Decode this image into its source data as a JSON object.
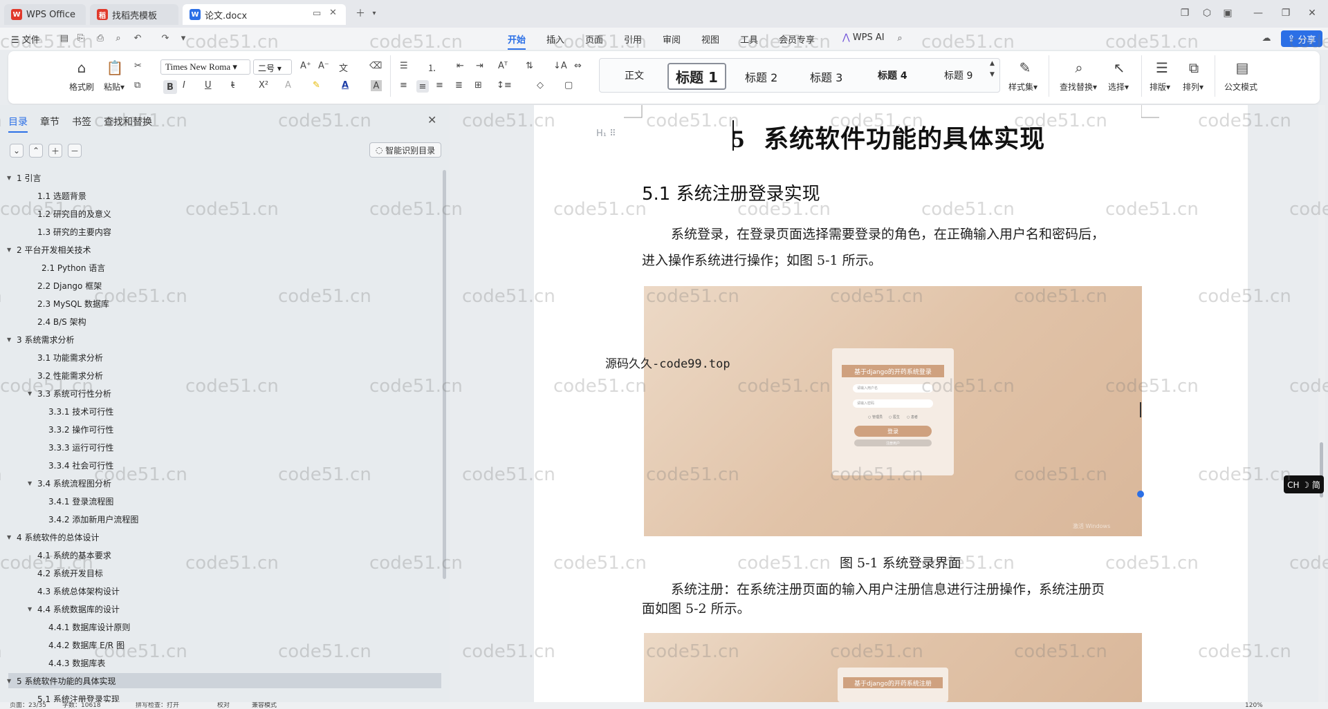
{
  "tabs": [
    {
      "label": "WPS Office",
      "logo": "W",
      "logo_color": "#e0392b"
    },
    {
      "label": "找稻壳模板",
      "logo": "稻",
      "logo_color": "#e0392b"
    },
    {
      "label": "论文.docx",
      "logo": "W",
      "logo_color": "#2b6fe6"
    }
  ],
  "quick": {
    "file": "文件"
  },
  "menu_tabs": [
    "开始",
    "插入",
    "页面",
    "引用",
    "审阅",
    "视图",
    "工具",
    "会员专享"
  ],
  "wps_ai": "WPS AI",
  "share": "分享",
  "ribbon": {
    "format_painter": "格式刷",
    "paste": "粘贴",
    "font": "Times New Roma",
    "size": "二号",
    "styles": [
      "正文",
      "标题 1",
      "标题 2",
      "标题 3",
      "标题 4",
      "标题 9"
    ],
    "style_set": "样式集",
    "find_replace": "查找替换",
    "select": "选择",
    "layout": "排版",
    "arrange": "排列",
    "official_mode": "公文模式",
    "accent": "#2b6fe6"
  },
  "nav": {
    "tabs": [
      "目录",
      "章节",
      "书签",
      "查找和替换"
    ],
    "smart_toc": "智能识别目录",
    "toc": [
      {
        "label": "1  引言",
        "level": 1,
        "caret": true
      },
      {
        "label": "1.1  选题背景",
        "level": 2
      },
      {
        "label": "1.2  研究目的及意义",
        "level": 2
      },
      {
        "label": "1.3  研究的主要内容",
        "level": 2
      },
      {
        "label": "2  平台开发相关技术",
        "level": 1,
        "caret": true
      },
      {
        "label": "2.1 Python 语言",
        "level": 2,
        "extra": true
      },
      {
        "label": "2.2 Django 框架",
        "level": 2
      },
      {
        "label": "2.3 MySQL 数据库",
        "level": 2
      },
      {
        "label": "2.4 B/S 架构",
        "level": 2
      },
      {
        "label": "3 系统需求分析",
        "level": 1,
        "caret": true
      },
      {
        "label": "3.1  功能需求分析",
        "level": 2
      },
      {
        "label": "3.2 性能需求分析",
        "level": 2
      },
      {
        "label": "3.3  系统可行性分析",
        "level": 2,
        "caret": true
      },
      {
        "label": "3.3.1  技术可行性",
        "level": 3
      },
      {
        "label": "3.3.2  操作可行性",
        "level": 3
      },
      {
        "label": "3.3.3 运行可行性",
        "level": 3
      },
      {
        "label": "3.3.4 社会可行性",
        "level": 3
      },
      {
        "label": "3.4 系统流程图分析",
        "level": 2,
        "caret": true
      },
      {
        "label": "3.4.1  登录流程图",
        "level": 3
      },
      {
        "label": "3.4.2  添加新用户流程图",
        "level": 3
      },
      {
        "label": "4  系统软件的总体设计",
        "level": 1,
        "caret": true
      },
      {
        "label": "4.1 系统的基本要求",
        "level": 2
      },
      {
        "label": "4.2  系统开发目标",
        "level": 2
      },
      {
        "label": "4.3  系统总体架构设计",
        "level": 2
      },
      {
        "label": "4.4  系统数据库的设计",
        "level": 2,
        "caret": true
      },
      {
        "label": "4.4.1 数据库设计原则",
        "level": 3
      },
      {
        "label": "4.4.2 数据库 E/R 图",
        "level": 3
      },
      {
        "label": "4.4.3  数据库表",
        "level": 3
      },
      {
        "label": "5  系统软件功能的具体实现",
        "level": 1,
        "caret": true,
        "selected": true
      },
      {
        "label": "5.1 系统注册登录实现",
        "level": 2
      }
    ]
  },
  "doc": {
    "heading_marker": "H₁",
    "h1_num": "5",
    "h1_text": "系统软件功能的具体实现",
    "h2": "5.1 系统注册登录实现",
    "para1_line1": "系统登录，在登录页面选择需要登录的角色，在正确输入用户名和密码后，",
    "para1_line2": "进入操作系统进行操作；如图 5-1 所示。",
    "fig1": {
      "title": "基于django的开药系统登录",
      "user_placeholder": "请输入用户名",
      "pwd_placeholder": "请输入密码",
      "roles": [
        "管理员",
        "医生",
        "患者"
      ],
      "login": "登录",
      "register": "注册用户",
      "windows_text": "激活 Windows"
    },
    "overlay": "源码久久-code99.top",
    "caption1": "图 5-1  系统登录界面",
    "para2_line1": "系统注册：在系统注册页面的输入用户注册信息进行注册操作，系统注册页",
    "para2_line2": "面如图 5-2 所示。",
    "fig2_title": "基于django的开药系统注册"
  },
  "ime": "CH ☽ 简",
  "status": {
    "page": "页面：23/35",
    "words": "字数：10618",
    "spell": "拼写检查：打开",
    "proof": "校对",
    "compat": "兼容模式",
    "zoom": "120%"
  },
  "watermark": "code51.cn"
}
